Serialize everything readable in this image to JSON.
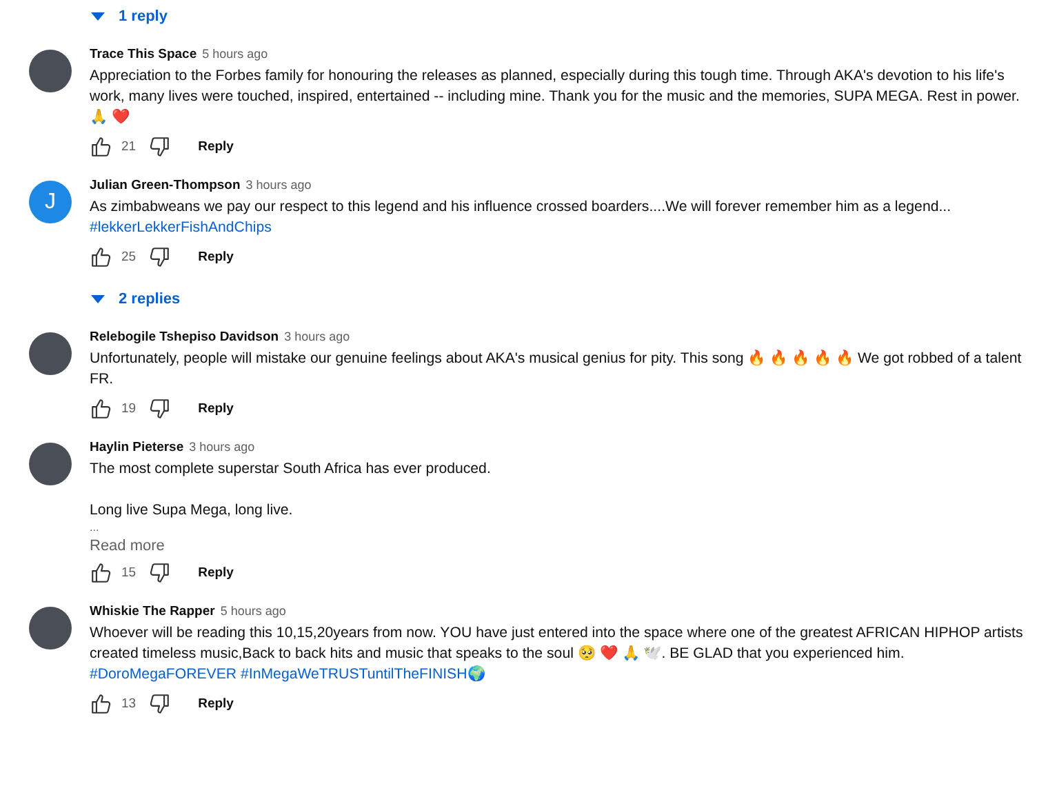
{
  "items": [
    {
      "kind": "replies",
      "label": "1 reply"
    },
    {
      "kind": "comment",
      "author": "Trace This Space",
      "time": "5 hours ago",
      "avatar": {
        "kind": "photo"
      },
      "paragraphs": [
        {
          "kind": "text",
          "text": "Appreciation to the Forbes family for honouring the releases as planned, especially during this tough time. Through AKA's devotion to his life's work, many lives were touched, inspired, entertained -- including mine. Thank you for the music and the memories, SUPA MEGA. Rest in power. 🙏 ❤️"
        }
      ],
      "likes": "21",
      "reply": "Reply"
    },
    {
      "kind": "comment",
      "author": "Julian Green-Thompson",
      "time": "3 hours ago",
      "avatar": {
        "kind": "letter",
        "letter": "J"
      },
      "paragraphs": [
        {
          "kind": "text",
          "text": "As zimbabweans we pay our respect to this legend and his influence crossed boarders....We will forever remember him as a legend..."
        },
        {
          "kind": "hashtags",
          "text": "#lekkerLekkerFishAndChips"
        }
      ],
      "likes": "25",
      "reply": "Reply"
    },
    {
      "kind": "replies",
      "label": "2 replies"
    },
    {
      "kind": "comment",
      "author": "Relebogile Tshepiso Davidson",
      "time": "3 hours ago",
      "avatar": {
        "kind": "photo"
      },
      "paragraphs": [
        {
          "kind": "text",
          "text": "Unfortunately, people will mistake our genuine feelings about AKA's musical genius for pity. This song 🔥 🔥 🔥 🔥 🔥  We got robbed of a talent FR."
        }
      ],
      "likes": "19",
      "reply": "Reply"
    },
    {
      "kind": "comment",
      "author": "Haylin Pieterse",
      "time": "3 hours ago",
      "avatar": {
        "kind": "photo"
      },
      "paragraphs": [
        {
          "kind": "text",
          "text": "The most complete superstar South Africa has ever produced."
        },
        {
          "kind": "gap"
        },
        {
          "kind": "text",
          "text": "Long live Supa Mega, long live."
        },
        {
          "kind": "more",
          "text": "..."
        }
      ],
      "read_more": "Read more",
      "likes": "15",
      "reply": "Reply"
    },
    {
      "kind": "comment",
      "author": "Whiskie The Rapper",
      "time": "5 hours ago",
      "avatar": {
        "kind": "photo"
      },
      "paragraphs": [
        {
          "kind": "text",
          "text": "Whoever will be reading this 10,15,20years from now. YOU have just entered into the space where one of the greatest AFRICAN HIPHOP artists created timeless music,Back to back hits and music that speaks to the soul 🥺 ❤️ 🙏 🕊️. BE GLAD that you experienced him."
        },
        {
          "kind": "hashtags",
          "text": "#DoroMegaFOREVER #InMegaWeTRUSTuntilTheFINISH🌍"
        }
      ],
      "likes": "13",
      "reply": "Reply"
    }
  ]
}
